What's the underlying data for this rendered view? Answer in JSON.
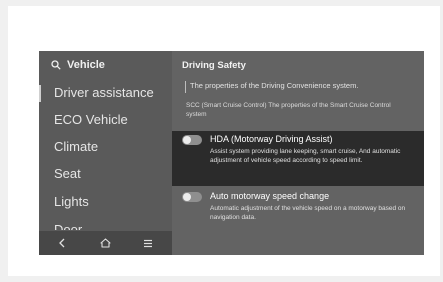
{
  "sidebar": {
    "header": "Vehicle",
    "items": [
      {
        "label": "Driver assistance"
      },
      {
        "label": "ECO Vehicle"
      },
      {
        "label": "Climate"
      },
      {
        "label": "Seat"
      },
      {
        "label": "Lights"
      },
      {
        "label": "Door"
      }
    ],
    "bottom_nav": [
      {
        "icon": "back-icon"
      },
      {
        "icon": "home-icon"
      },
      {
        "icon": "menu-icon"
      }
    ]
  },
  "content": {
    "title": "Driving Safety",
    "description_main": "The properties of the Driving Convenience system.",
    "description_secondary": "SCC (Smart Cruise Control) The properties of the Smart Cruise Control system",
    "options": [
      {
        "title": "HDA (Motorway Driving Assist)",
        "description": "Assist system providing lane keeping, smart cruise, And automatic adjustment of vehicle speed according to speed limit.",
        "enabled": false
      },
      {
        "title": "Auto motorway speed change",
        "description": "Automatic adjustment of the vehicle speed on a motorway based on navigation data.",
        "enabled": false
      }
    ]
  },
  "colors": {
    "screen_bg": "#636363",
    "sidebar_bg": "#5a5a5a",
    "highlight_bg": "#2b2b2b",
    "text": "#ffffff"
  }
}
